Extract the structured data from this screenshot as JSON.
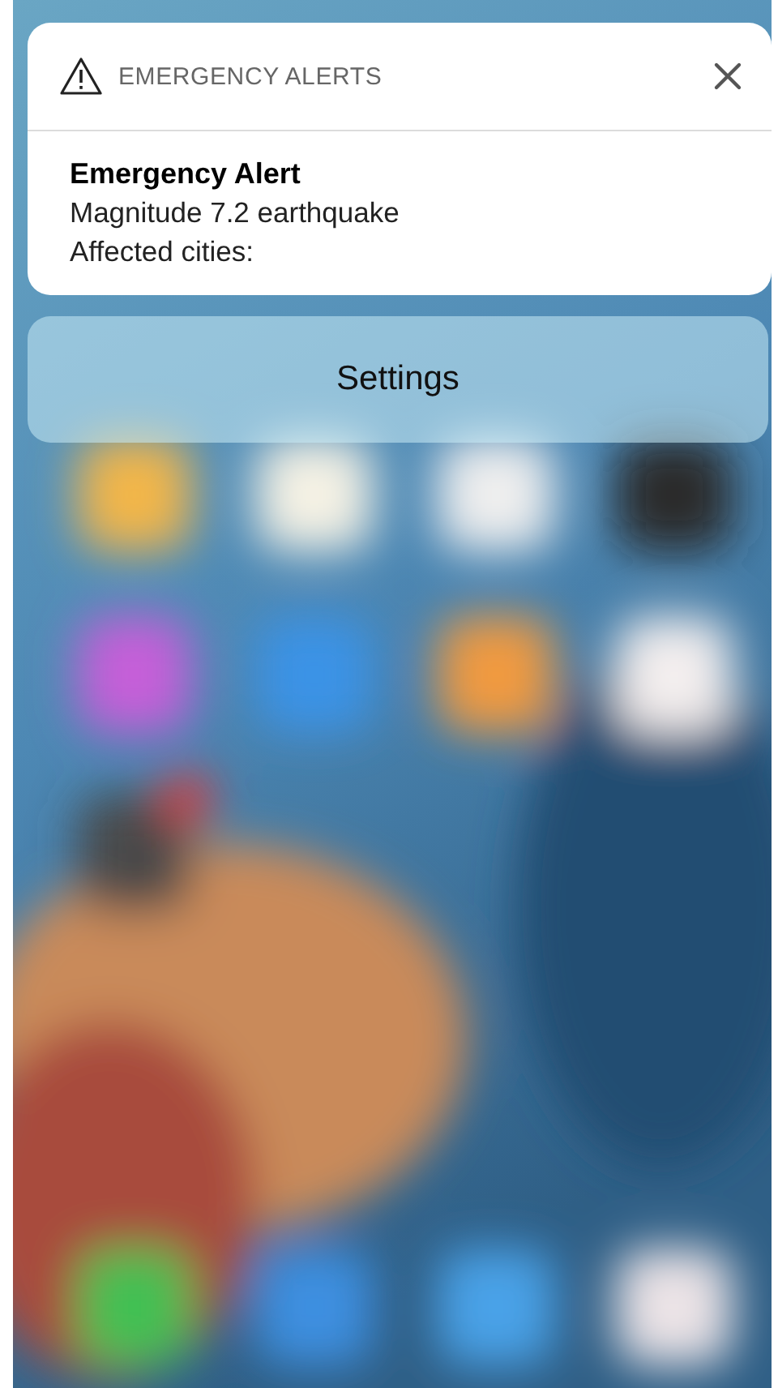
{
  "alert": {
    "app_name": "EMERGENCY ALERTS",
    "title": "Emergency Alert",
    "lines": [
      "Magnitude 7.2 earthquake",
      "Affected cities:"
    ]
  },
  "actions": [
    {
      "label": "Settings"
    }
  ]
}
